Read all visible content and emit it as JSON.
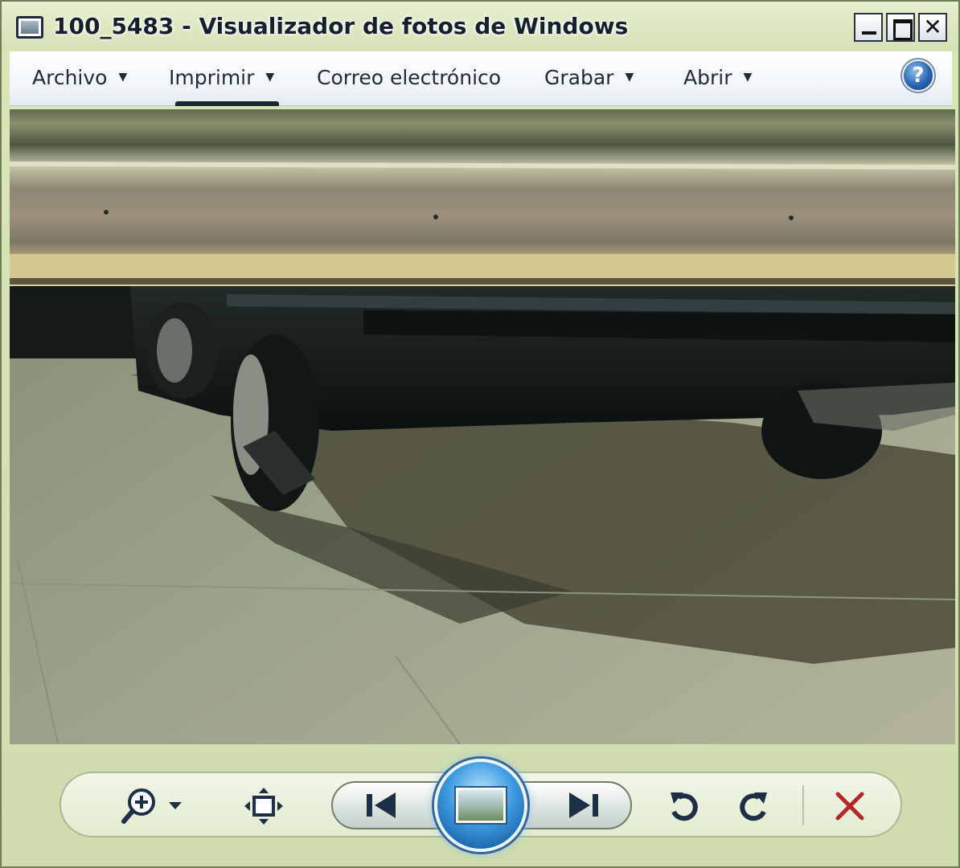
{
  "window": {
    "title": "100_5483 - Visualizador de fotos de Windows",
    "controls": {
      "minimize": "_",
      "maximize": "□",
      "close": "✕"
    }
  },
  "menu": {
    "items": [
      {
        "label": "Archivo",
        "has_dropdown": true
      },
      {
        "label": "Imprimir",
        "has_dropdown": true
      },
      {
        "label": "Correo electrónico",
        "has_dropdown": false
      },
      {
        "label": "Grabar",
        "has_dropdown": true
      },
      {
        "label": "Abrir",
        "has_dropdown": true
      }
    ],
    "help": {
      "icon": "help-icon",
      "glyph": "?"
    },
    "caret": "▼"
  },
  "photo": {
    "description_icon": "photo-image"
  },
  "controls": {
    "zoom": {
      "icon": "zoom-icon"
    },
    "fit": {
      "icon": "actual-size-icon"
    },
    "previous": {
      "icon": "previous-icon"
    },
    "slideshow": {
      "icon": "slideshow-icon"
    },
    "next": {
      "icon": "next-icon"
    },
    "rotate_left": {
      "icon": "rotate-counterclockwise-icon"
    },
    "rotate_right": {
      "icon": "rotate-clockwise-icon"
    },
    "delete": {
      "icon": "delete-icon",
      "glyph": "✕"
    }
  },
  "colors": {
    "title_bar": "#dbe7c2",
    "menu_bar": "#f2f6fa",
    "accent_blue": "#2a64b4",
    "delete_red": "#b2272a"
  }
}
